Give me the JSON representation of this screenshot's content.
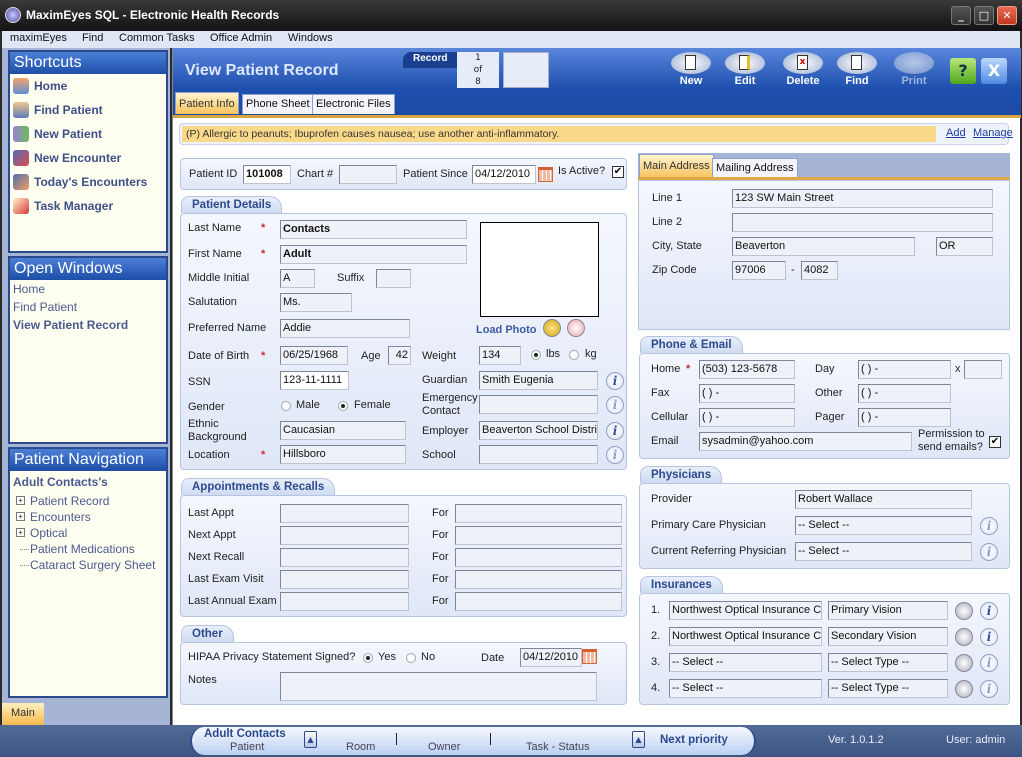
{
  "window": {
    "title": "MaximEyes SQL - Electronic Health Records",
    "min": "_",
    "max": "□",
    "close": "✕"
  },
  "menu": [
    "maximEyes",
    "Find",
    "Common Tasks",
    "Office Admin",
    "Windows"
  ],
  "shortcuts": {
    "title": "Shortcuts",
    "items": [
      {
        "label": "Home",
        "icon": "home-icon"
      },
      {
        "label": "Find Patient",
        "icon": "find-patient-icon"
      },
      {
        "label": "New Patient",
        "icon": "new-patient-icon"
      },
      {
        "label": "New Encounter",
        "icon": "new-encounter-icon"
      },
      {
        "label": "Today's Encounters",
        "icon": "todays-encounters-icon"
      },
      {
        "label": "Task Manager",
        "icon": "task-manager-icon"
      }
    ]
  },
  "open_windows": {
    "title": "Open Windows",
    "items": [
      "Home",
      "Find Patient",
      "View Patient Record"
    ]
  },
  "patient_nav": {
    "title": "Patient Navigation",
    "patient": "Adult Contacts's",
    "items": [
      {
        "label": "Patient Record",
        "expandable": true
      },
      {
        "label": "Encounters",
        "expandable": true
      },
      {
        "label": "Optical",
        "expandable": true
      },
      {
        "label": "Patient Medications",
        "expandable": false
      },
      {
        "label": "Cataract Surgery Sheet",
        "expandable": false
      }
    ]
  },
  "left_tab": "Main",
  "header": {
    "title": "View Patient Record",
    "record_label": "Record",
    "record_current": "1",
    "record_of": "of",
    "record_total": "8",
    "toolbar": {
      "new": "New",
      "edit": "Edit",
      "delete": "Delete",
      "find": "Find",
      "print": "Print"
    },
    "help": "?",
    "close": "X"
  },
  "tabs": [
    "Patient Info",
    "Phone Sheet",
    "Electronic Files"
  ],
  "allergy": {
    "text": "(P) Allergic to peanuts; Ibuprofen causes nausea; use another anti-inflammatory.",
    "add": "Add",
    "manage": "Manage"
  },
  "idbar": {
    "patient_id_label": "Patient ID",
    "patient_id": "101008",
    "chart_label": "Chart #",
    "chart": "",
    "since_label": "Patient Since",
    "since": "04/12/2010",
    "active_label": "Is Active?",
    "active": "✔"
  },
  "details": {
    "title": "Patient Details",
    "last_name_label": "Last Name",
    "last_name": "Contacts",
    "first_name_label": "First Name",
    "first_name": "Adult",
    "middle_label": "Middle Initial",
    "middle": "A",
    "suffix_label": "Suffix",
    "suffix": "",
    "salutation_label": "Salutation",
    "salutation": "Ms.",
    "preferred_label": "Preferred Name",
    "preferred": "Addie",
    "load_photo": "Load Photo",
    "dob_label": "Date of Birth",
    "dob": "06/25/1968",
    "age_label": "Age",
    "age": "42",
    "weight_label": "Weight",
    "weight": "134",
    "lbs": "lbs",
    "kg": "kg",
    "ssn_label": "SSN",
    "ssn": "123-11-1111",
    "guardian_label": "Guardian",
    "guardian": "Smith Eugenia",
    "gender_label": "Gender",
    "male": "Male",
    "female": "Female",
    "emergency_label1": "Emergency",
    "emergency_label2": "Contact",
    "emergency": "",
    "ethnic_label1": "Ethnic",
    "ethnic_label2": "Background",
    "ethnic": "Caucasian",
    "employer_label": "Employer",
    "employer": "Beaverton School Distric",
    "location_label": "Location",
    "location": "Hillsboro",
    "school_label": "School",
    "school": "",
    "required": "*"
  },
  "appointments": {
    "title": "Appointments & Recalls",
    "for_label": "For",
    "rows": [
      {
        "label": "Last Appt",
        "value": "",
        "for": ""
      },
      {
        "label": "Next Appt",
        "value": "",
        "for": ""
      },
      {
        "label": "Next Recall",
        "value": "",
        "for": ""
      },
      {
        "label": "Last Exam Visit",
        "value": "",
        "for": ""
      },
      {
        "label": "Last Annual Exam",
        "value": "",
        "for": ""
      }
    ]
  },
  "other": {
    "title": "Other",
    "hipaa_label": "HIPAA Privacy Statement Signed?",
    "yes": "Yes",
    "no": "No",
    "date_label": "Date",
    "date": "04/12/2010",
    "notes_label": "Notes",
    "notes": ""
  },
  "address": {
    "tabs": [
      "Main Address",
      "Mailing Address"
    ],
    "line1_label": "Line 1",
    "line1": "123 SW Main Street",
    "line2_label": "Line 2",
    "line2": "",
    "city_label": "City, State",
    "city": "Beaverton",
    "state": "OR",
    "zip_label": "Zip Code",
    "zip": "97006",
    "zip_dash": "-",
    "zip4": "4082"
  },
  "phone": {
    "title": "Phone & Email",
    "home_label": "Home",
    "home": "(503) 123-5678",
    "day_label": "Day",
    "day": "(  )    -",
    "ext_label": "x",
    "ext": "",
    "fax_label": "Fax",
    "fax": "(  )    -",
    "other_label": "Other",
    "other": "(  )    -",
    "cell_label": "Cellular",
    "cell": "(  )    -",
    "pager_label": "Pager",
    "pager": "(  )    -",
    "email_label": "Email",
    "email": "sysadmin@yahoo.com",
    "perm_label1": "Permission to",
    "perm_label2": "send emails?",
    "perm": "✔"
  },
  "physicians": {
    "title": "Physicians",
    "provider_label": "Provider",
    "provider": "Robert Wallace",
    "pcp_label": "Primary Care Physician",
    "pcp": "-- Select --",
    "ref_label": "Current Referring Physician",
    "ref": "-- Select --"
  },
  "insurances": {
    "title": "Insurances",
    "rows": [
      {
        "num": "1.",
        "carrier": "Northwest Optical Insurance Co",
        "type": "Primary Vision"
      },
      {
        "num": "2.",
        "carrier": "Northwest Optical Insurance Co",
        "type": "Secondary Vision"
      },
      {
        "num": "3.",
        "carrier": "-- Select --",
        "type": "-- Select Type --"
      },
      {
        "num": "4.",
        "carrier": "-- Select --",
        "type": "-- Select Type --"
      }
    ]
  },
  "statusbar": {
    "patient_value": "Adult Contacts",
    "patient_label": "Patient",
    "room_label": "Room",
    "owner_label": "Owner",
    "task_label": "Task - Status",
    "next_priority": "Next priority",
    "version": "Ver. 1.0.1.2",
    "user": "User: admin"
  }
}
